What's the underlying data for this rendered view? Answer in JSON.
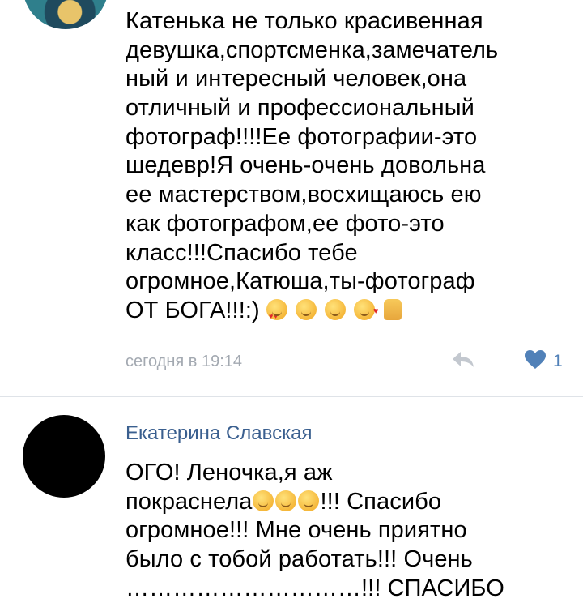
{
  "comments": [
    {
      "lines": [
        "Катенька не только красивенная",
        "девушка,спортсменка,замечатель",
        "ный и интересный человек,она",
        "отличный и профессиональный",
        "фотограф!!!!Ее фотографии-это",
        "шедевр!Я очень-очень довольна",
        "ее мастерством,восхищаюсь ею",
        "как фотографом,ее фото-это",
        "класс!!!Спасибо тебе",
        "огромное,Катюша,ты-фотограф",
        "ОТ БОГА!!!:)"
      ],
      "trailing_emojis": [
        "heart-eyes-emoji",
        "relieved-emoji",
        "smile-emoji",
        "kiss-emoji",
        "thumbs-up-emoji"
      ],
      "timestamp": "сегодня в 19:14",
      "like_count": "1",
      "reply_icon": "reply-arrow-icon",
      "like_icon": "heart-icon"
    },
    {
      "author": "Екатерина Славская",
      "line_1": "ОГО! Леночка,я аж",
      "line_2_start": "покраснела",
      "line_2_end": "!!! Спасибо",
      "line_3": "огромное!!! Мне очень приятно",
      "line_4": "было с тобой работать!!! Очень",
      "line_5_partial": "…………………………!!! СПАСИБО"
    }
  ],
  "colors": {
    "author_link": "#3a5f8f",
    "meta_text": "#a3a9b1",
    "like_active": "#5181b8",
    "divider": "#dfe3e8"
  }
}
